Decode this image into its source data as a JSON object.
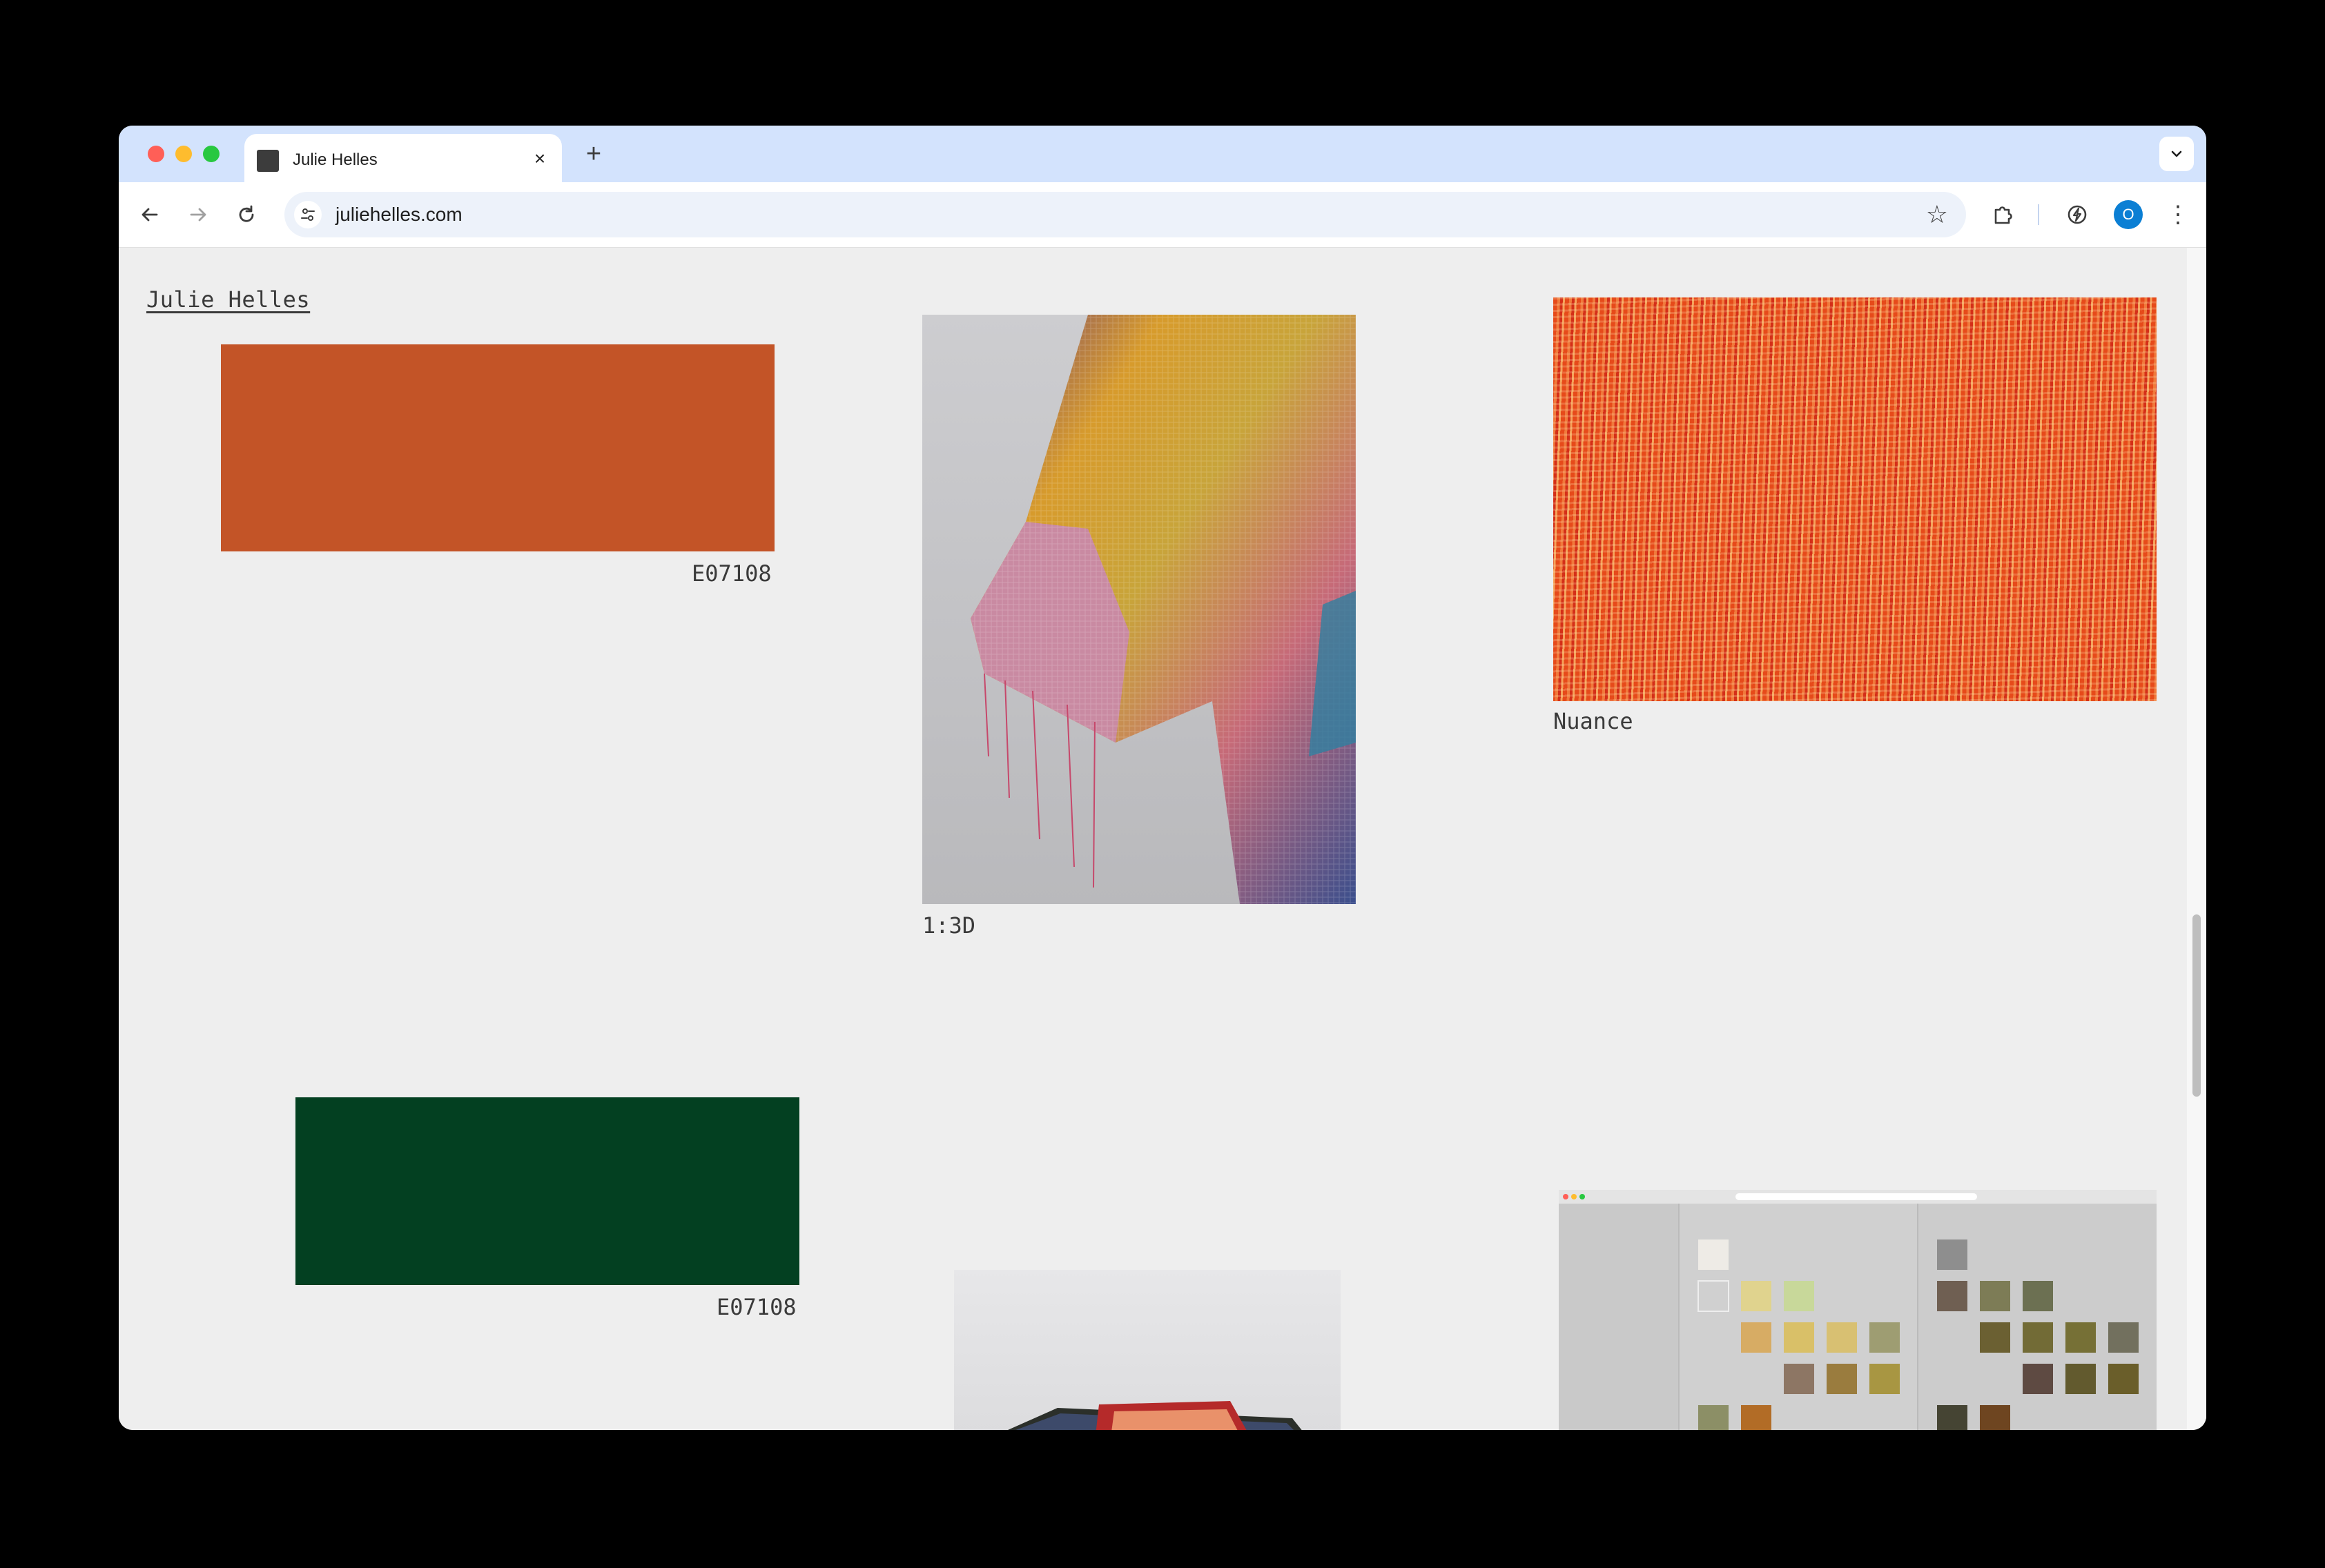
{
  "browser": {
    "tab_title": "Julie Helles",
    "url": "juliehelles.com",
    "avatar_letter": "O"
  },
  "page": {
    "site_name": "Julie Helles",
    "items": [
      {
        "kind": "swatch",
        "color": "#c35427",
        "caption": "E07108"
      },
      {
        "kind": "image",
        "subject": "woven knit sleeve in multicolor yarn",
        "caption": "1:3D"
      },
      {
        "kind": "image",
        "subject": "orange red fiber texture close-up",
        "caption": "Nuance"
      },
      {
        "kind": "swatch",
        "color": "#034021",
        "caption": "E07108"
      },
      {
        "kind": "image",
        "subject": "woven tray with red inner box",
        "caption": ""
      },
      {
        "kind": "image",
        "subject": "screenshot of colour archive website",
        "caption": ""
      }
    ]
  },
  "colors": {
    "tabstrip": "#d3e3fd",
    "page_background": "#eeeeee",
    "orange_swatch": "#c35427",
    "green_swatch": "#034021"
  }
}
